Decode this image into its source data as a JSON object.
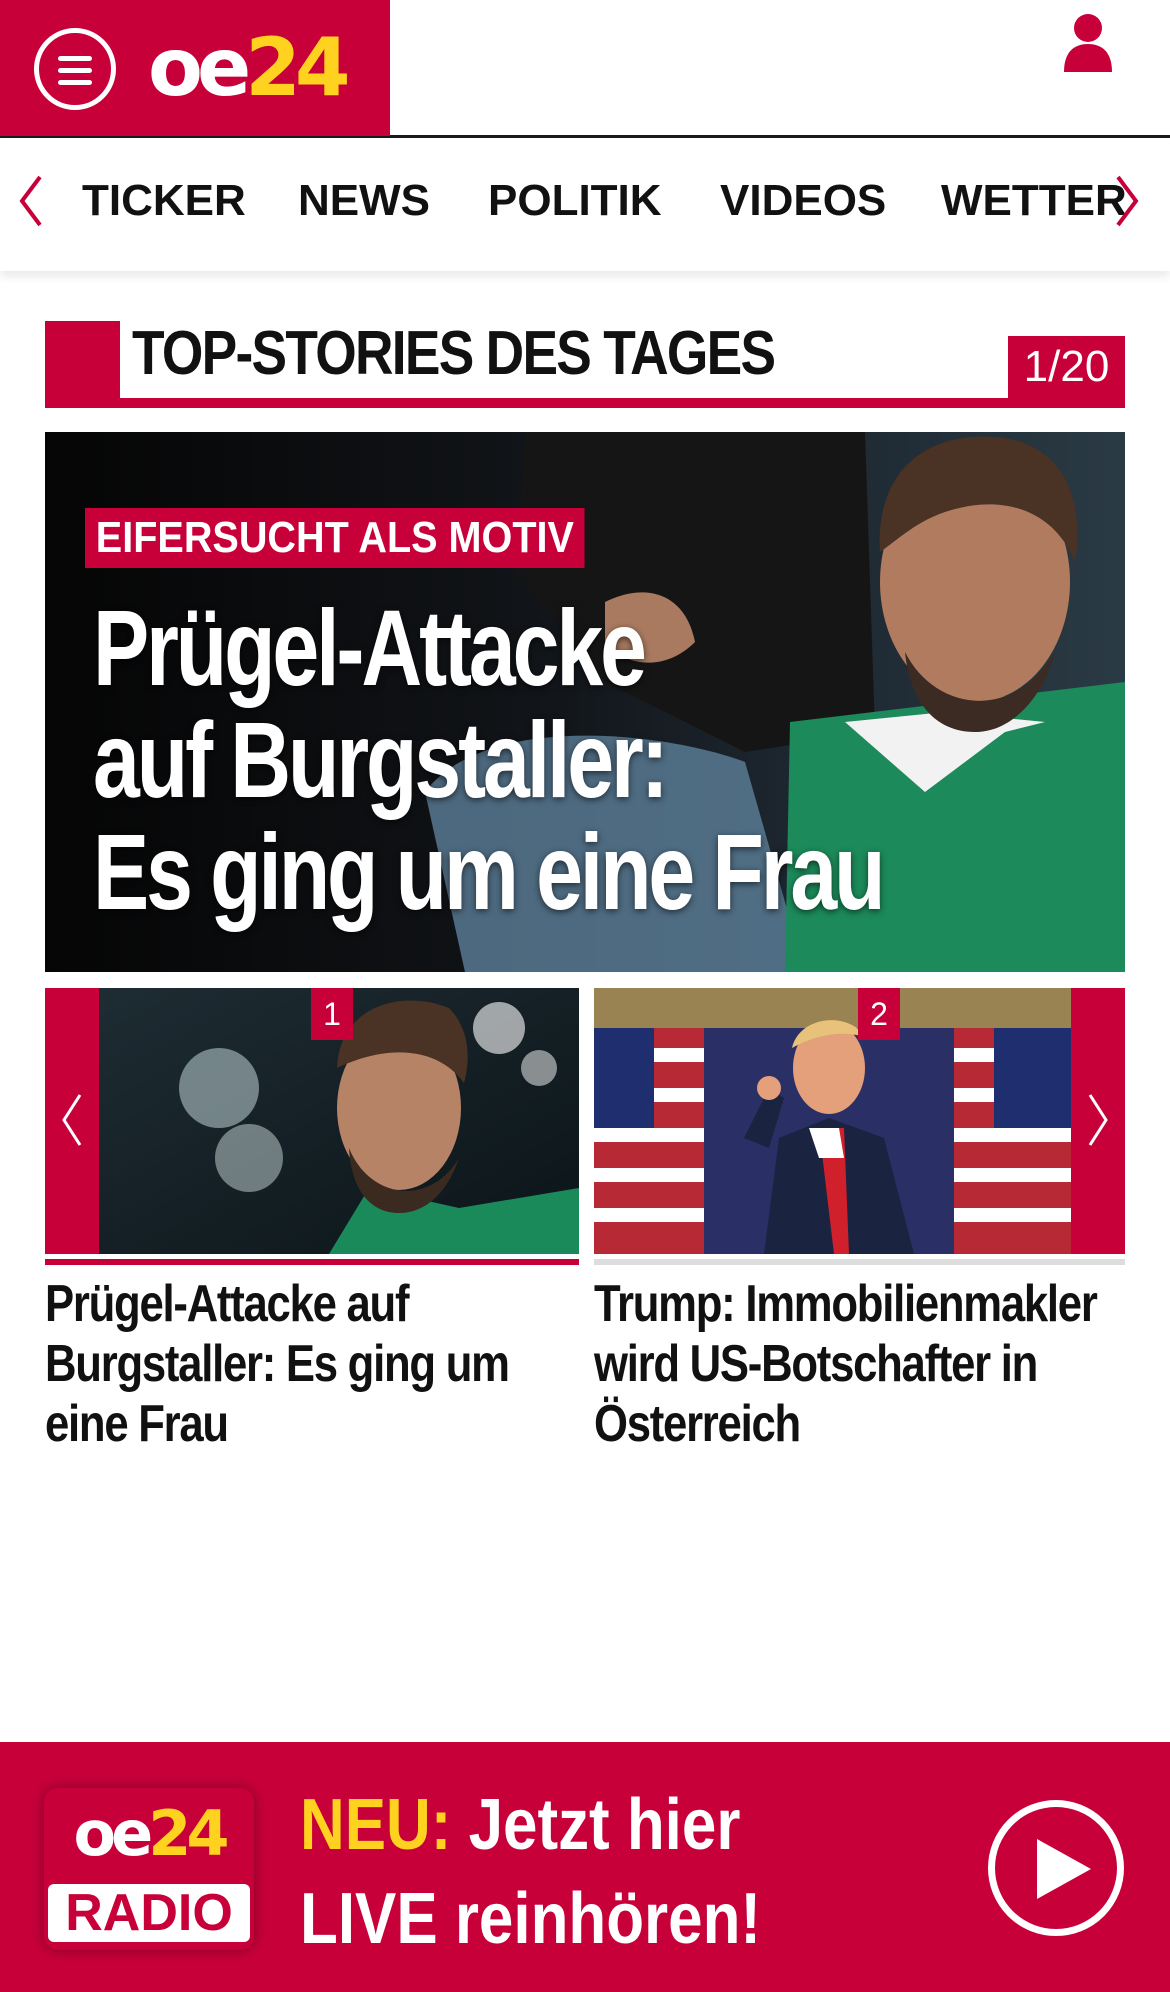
{
  "header": {
    "logo_main": "oe",
    "logo_number": "24",
    "menu_icon": "hamburger-menu-icon",
    "user_icon": "user-icon"
  },
  "nav": {
    "items": [
      {
        "label": "TICKER"
      },
      {
        "label": "NEWS"
      },
      {
        "label": "POLITIK"
      },
      {
        "label": "VIDEOS"
      },
      {
        "label": "WETTER"
      }
    ]
  },
  "section": {
    "title": "TOP-STORIES DES TAGES",
    "counter": "1/20"
  },
  "hero": {
    "kicker": "EIFERSUCHT ALS MOTIV",
    "title_lines": [
      "Prügel-Attacke",
      "auf Burgstaller:",
      "Es ging um eine Frau"
    ]
  },
  "carousel": {
    "cards": [
      {
        "badge": "1",
        "title_lines": [
          "Prügel-Attacke auf",
          "Burgstaller: Es ging um",
          "eine Frau"
        ]
      },
      {
        "badge": "2",
        "title_lines": [
          "Trump: Immobilienmakler",
          "wird US-Botschafter in",
          "Österreich"
        ]
      }
    ]
  },
  "radio": {
    "logo_main": "oe",
    "logo_number": "24",
    "logo_label": "RADIO",
    "highlight": "NEU:",
    "line1": "Jetzt hier",
    "line2": "LIVE reinhören!"
  },
  "colors": {
    "brand_red": "#c8003a",
    "logo_yellow": "#ffd21f"
  }
}
